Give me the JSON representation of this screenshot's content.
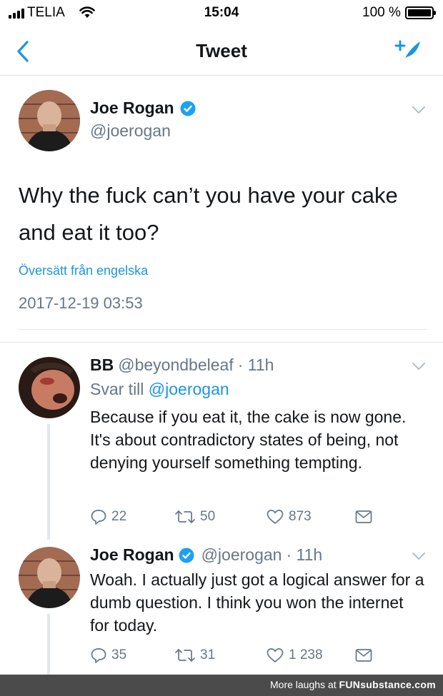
{
  "status": {
    "carrier": "TELIA",
    "time": "15:04",
    "battery": "100 %"
  },
  "nav": {
    "title": "Tweet"
  },
  "main_tweet": {
    "name": "Joe Rogan",
    "handle": "@joerogan",
    "text": "Why the fuck can’t you have your cake and eat it too?",
    "translate": "Översätt från engelska",
    "timestamp": "2017-12-19 03:53"
  },
  "replies": [
    {
      "name": "BB",
      "handle": "@beyondbeleaf",
      "time": "· 11h",
      "reply_to_prefix": "Svar till",
      "reply_to": "@joerogan",
      "text": "Because if you eat it, the cake is now gone. It's about contradictory states of being, not denying yourself something tempting.",
      "replies": "22",
      "retweets": "50",
      "likes": "873"
    },
    {
      "name": "Joe Rogan",
      "handle": "@joerogan",
      "time": "· 11h",
      "text": "Woah. I actually just got a logical answer for a dumb question. I think you won the internet for today.",
      "replies": "35",
      "retweets": "31",
      "likes": "1 238"
    }
  ],
  "footer": {
    "text": "More laughs at",
    "brand": "FUNsubstance.com"
  },
  "colors": {
    "accent": "#1b95e0",
    "secondary_text": "#657786",
    "divider": "#e1e8ed"
  },
  "icons": [
    "signal-icon",
    "wifi-icon",
    "battery-icon",
    "back-chevron-icon",
    "compose-tweet-icon",
    "verified-badge-icon",
    "chevron-down-icon",
    "reply-icon",
    "retweet-icon",
    "like-icon",
    "message-icon"
  ]
}
